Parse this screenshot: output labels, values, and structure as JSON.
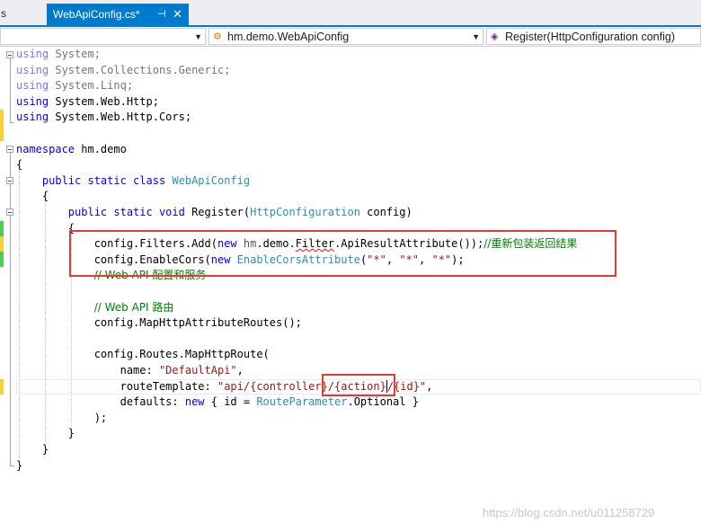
{
  "tabs": {
    "previous_fragment": "s",
    "active_label": "WebApiConfig.cs*",
    "pin_glyph": "⊣",
    "close_glyph": "✕"
  },
  "navbar": {
    "project": "",
    "class_combo": "hm.demo.WebApiConfig",
    "member_combo": "Register(HttpConfiguration config)"
  },
  "code": {
    "using1": [
      "using",
      " System;"
    ],
    "using2": [
      "using",
      " System.Collections.Generic;"
    ],
    "using3": [
      "using",
      " System.Linq;"
    ],
    "using4": [
      "using",
      " System.Web.Http;"
    ],
    "using5": [
      "using",
      " System.Web.Http.Cors;"
    ],
    "ns_kw": "namespace",
    "ns_name": " hm.demo",
    "brace_open": "{",
    "brace_close": "}",
    "class_kws": "public static class ",
    "class_name": "WebApiConfig",
    "method_kws": "public static void ",
    "method_name": "Register(",
    "method_ptype": "HttpConfiguration",
    "method_pname": " config)",
    "filters_pre": "config.Filters.Add(",
    "new_kw": "new",
    "filters_ns": " hm",
    "filters_dot": ".demo.",
    "filters_ns2": "Filter",
    "filters_post": ".ApiResultAttribute());",
    "filters_comment": "//重新包装返回结果",
    "cors_pre": "config.EnableCors(",
    "cors_type": " EnableCorsAttribute",
    "cors_args_open": "(",
    "cors_star": "\"*\"",
    "cors_sep": ", ",
    "cors_close": ");",
    "comment_webapi_config": "// Web API 配置和服务",
    "comment_webapi_route": "// Web API 路由",
    "map_attr": "config.MapHttpAttributeRoutes();",
    "map_route": "config.Routes.MapHttpRoute(",
    "name_label": "name: ",
    "name_value": "\"DefaultApi\"",
    "comma": ",",
    "route_label": "routeTemplate: ",
    "route_value_a": "\"api/{controller}/",
    "route_value_b": "{action}",
    "route_value_c": "/{id}\"",
    "defaults_label": "defaults: ",
    "defaults_open": " { id = ",
    "defaults_type": "RouteParameter",
    "defaults_close": ".Optional }",
    "close_paren": ");"
  },
  "watermark": "https://blog.csdn.net/u011258729",
  "colors": {
    "accent": "#007acc",
    "keyword": "#0000ff",
    "type": "#2b91af",
    "string": "#a31515",
    "comment": "#008000",
    "annotation_red": "#e53935",
    "change_yellow": "#f4d03f",
    "change_green": "#57c957"
  }
}
